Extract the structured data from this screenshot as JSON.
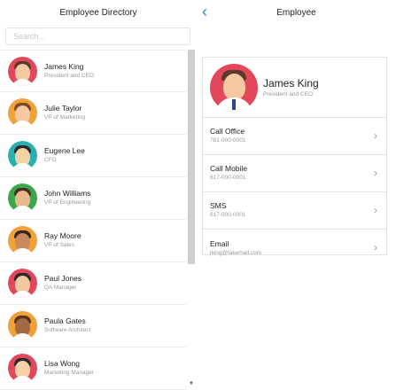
{
  "directory": {
    "title": "Employee Directory",
    "search_placeholder": "Search...",
    "employees": [
      {
        "name": "James King",
        "title": "President and CEO",
        "bg": "#e2475a",
        "hair": "#5a3a2a",
        "skin": "#f4c9a2"
      },
      {
        "name": "Julie Taylor",
        "title": "VP of Marketing",
        "bg": "#f0a13a",
        "hair": "#7a4a22",
        "skin": "#f4c9a2"
      },
      {
        "name": "Eugene Lee",
        "title": "CFO",
        "bg": "#2bb0b0",
        "hair": "#2a2a2a",
        "skin": "#f2d3a6"
      },
      {
        "name": "John Williams",
        "title": "VP of Engineering",
        "bg": "#3aa84a",
        "hair": "#4a2e1e",
        "skin": "#e8b98e"
      },
      {
        "name": "Ray Moore",
        "title": "VP of Sales",
        "bg": "#f0a13a",
        "hair": "#3a2618",
        "skin": "#c98b5e"
      },
      {
        "name": "Paul Jones",
        "title": "QA Manager",
        "bg": "#e2475a",
        "hair": "#2a2a2a",
        "skin": "#f0c8a0"
      },
      {
        "name": "Paula Gates",
        "title": "Software Architect",
        "bg": "#f0a13a",
        "hair": "#5a3218",
        "skin": "#a56a44"
      },
      {
        "name": "Lisa Wong",
        "title": "Marketing Manager",
        "bg": "#e2475a",
        "hair": "#2a2a2a",
        "skin": "#f6d0a8"
      }
    ]
  },
  "detail": {
    "title": "Employee",
    "back_icon": "chevron-left-icon",
    "name": "James King",
    "role": "President and CEO",
    "actions": [
      {
        "label": "Call Office",
        "value": "781-000-0001"
      },
      {
        "label": "Call Mobile",
        "value": "617-000-0001"
      },
      {
        "label": "SMS",
        "value": "617-000-0001"
      },
      {
        "label": "Email",
        "value": "jking@fakemail.com"
      }
    ]
  },
  "colors": {
    "accent": "#2b7ee6",
    "divider": "#e4e4e4",
    "muted": "#9a9a9a"
  }
}
